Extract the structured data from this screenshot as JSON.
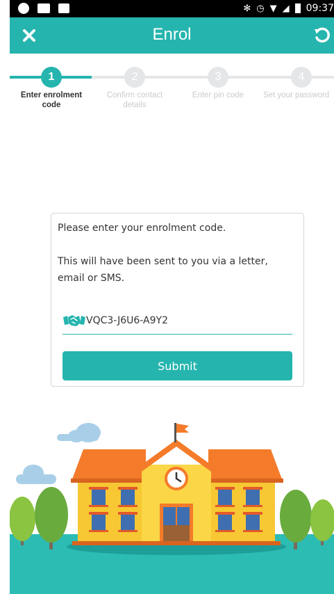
{
  "status_bar": {
    "time": "09:37"
  },
  "header": {
    "title": "Enrol",
    "close_icon": "close-icon",
    "refresh_icon": "refresh-icon"
  },
  "stepper": {
    "steps": [
      {
        "number": "1",
        "label": "Enter enrolment code",
        "active": true
      },
      {
        "number": "2",
        "label": "Confirm contact details",
        "active": false
      },
      {
        "number": "3",
        "label": "Enter pin code",
        "active": false
      },
      {
        "number": "4",
        "label": "Set your password",
        "active": false
      }
    ]
  },
  "card": {
    "prompt": "Please enter your enrolment code.",
    "hint": "This will have been sent to you via a letter, email or SMS.",
    "code_icon": "handshake-icon",
    "code_value": "VQC3-J6U6-A9Y2",
    "submit_label": "Submit"
  },
  "colors": {
    "accent": "#25b5ae",
    "inactive": "#e4e6e8",
    "school_wall": "#f7c833",
    "roof": "#f47b2a",
    "grass": "#2cbcb4"
  }
}
